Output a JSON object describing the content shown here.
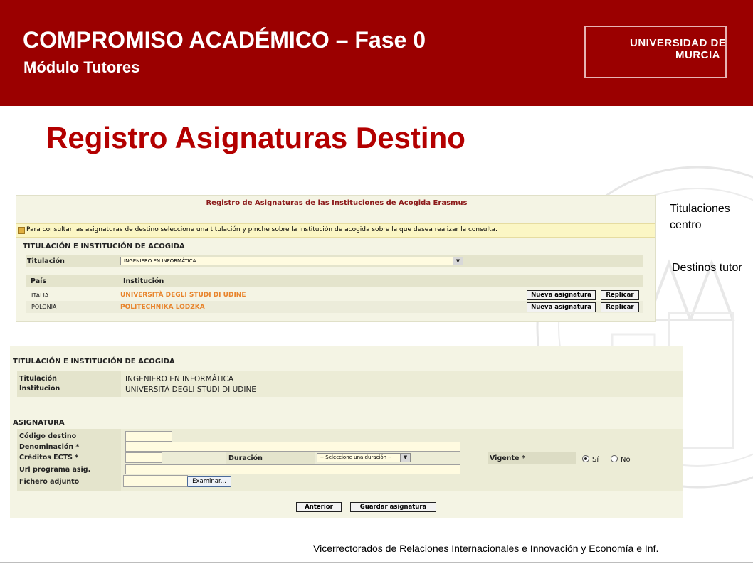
{
  "header": {
    "title": "COMPROMISO ACADÉMICO – Fase 0",
    "subtitle": "Módulo Tutores",
    "logo_line1": "UNIVERSIDAD DE",
    "logo_line2": "MURCIA"
  },
  "slide_title": "Registro Asignaturas Destino",
  "side_labels": {
    "titulaciones_line1": "Titulaciones",
    "titulaciones_line2": "centro",
    "destinos": "Destinos tutor"
  },
  "panel1": {
    "title": "Registro de Asignaturas de las Instituciones de Acogida Erasmus",
    "info": "Para consultar las asignaturas de destino seleccione una titulación y pinche sobre la institución de acogida sobre la que desea realizar la consulta.",
    "section": "TITULACIÓN E INSTITUCIÓN DE ACOGIDA",
    "titulacion_label": "Titulación",
    "titulacion_value": "INGENIERO EN INFORMÁTICA",
    "col_pais": "País",
    "col_institucion": "Institución",
    "rows": [
      {
        "pais": "ITALIA",
        "institucion": "UNIVERSITÀ DEGLI STUDI DI UDINE"
      },
      {
        "pais": "POLONIA",
        "institucion": "POLITECHNIKA LODZKA"
      }
    ],
    "btn_nueva": "Nueva asignatura",
    "btn_replicar": "Replicar"
  },
  "panel2": {
    "section1": "TITULACIÓN E INSTITUCIÓN DE ACOGIDA",
    "titulacion_label": "Titulación",
    "institucion_label": "Institución",
    "titulacion_value": "INGENIERO EN INFORMÁTICA",
    "institucion_value": "UNIVERSITÀ DEGLI STUDI DI UDINE",
    "section2": "ASIGNATURA",
    "codigo_label": "Código destino",
    "denominacion_label": "Denominación *",
    "creditos_label": "Créditos ECTS *",
    "duracion_label": "Duración",
    "duracion_value": "-- Seleccione una duración --",
    "vigente_label": "Vigente *",
    "radio_si": "Sí",
    "radio_no": "No",
    "url_label": "Url programa asig.",
    "fichero_label": "Fichero adjunto",
    "examinar": "Examinar...",
    "btn_anterior": "Anterior",
    "btn_guardar": "Guardar asignatura"
  },
  "footer": "Vicerrectorados de Relaciones Internacionales e Innovación y Economía e Inf.",
  "colors": {
    "header": "#9b0000",
    "title": "#b30000",
    "link": "#e8842c"
  }
}
